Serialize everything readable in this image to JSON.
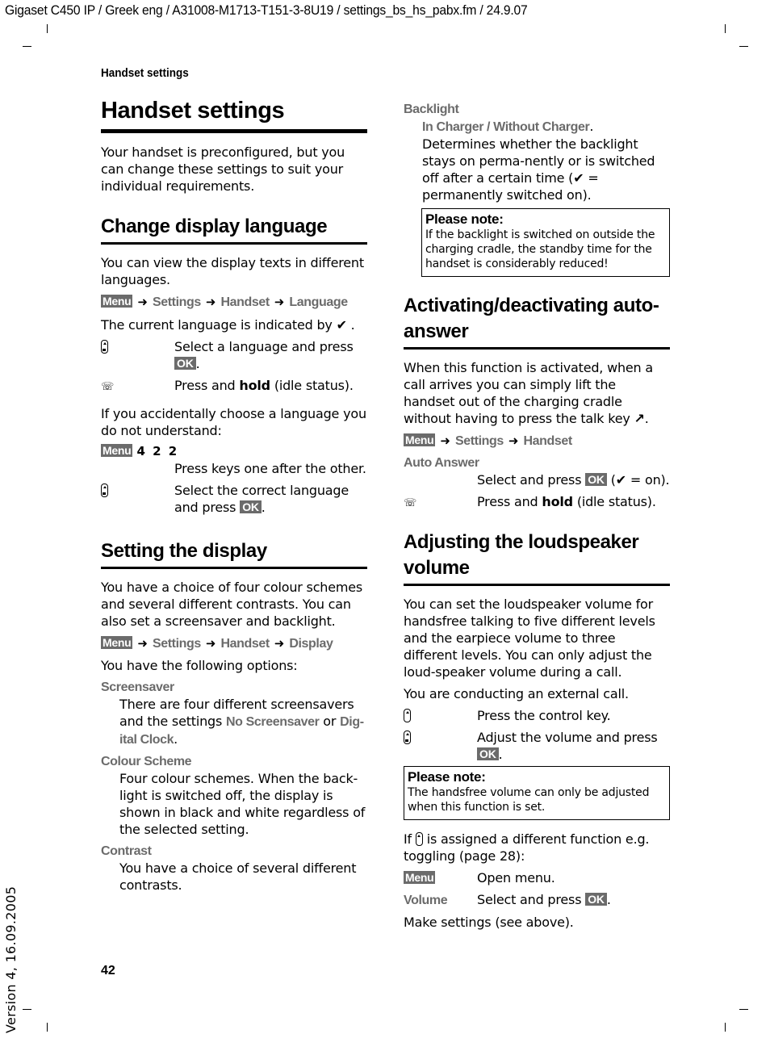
{
  "doc_header": "Gigaset C450 IP / Greek eng / A31008-M1713-T151-3-8U19 / settings_bs_hs_pabx.fm / 24.9.07",
  "running_head": "Handset settings",
  "page_number": "42",
  "version": "Version 4, 16.09.2005",
  "keys": {
    "menu": "Menu",
    "ok": "OK",
    "arrow": "➜",
    "check": "✔"
  },
  "icons": {
    "nav_key": "control-key-up-down",
    "nav_key_up": "control-key-up",
    "end_key": "end-key",
    "talk_key": "talk-key",
    "check": "checkmark"
  },
  "left": {
    "title": "Handset settings",
    "intro": "Your handset is preconfigured, but you can change these settings to suit your individual requirements.",
    "lang": {
      "heading": "Change display language",
      "intro": "You can view the display texts in different languages.",
      "path": [
        "Settings",
        "Handset",
        "Language"
      ],
      "current_text": "The current language is indicated by",
      "step1": "Select a language and press",
      "step2_a": "Press and",
      "step2_b": "hold",
      "step2_c": "(idle status).",
      "accident": "If you accidentally choose a language you do not understand:",
      "key_seq": "4 2 2",
      "step3": "Press keys one after the other.",
      "step4": "Select the correct language and press"
    },
    "display": {
      "heading": "Setting the display",
      "intro": "You have a choice of four colour schemes and several different contrasts. You can also set a screensaver and backlight.",
      "path": [
        "Settings",
        "Handset",
        "Display"
      ],
      "options_intro": "You have the following options:",
      "screensaver_label": "Screensaver",
      "screensaver_text_a": "There are four different screensavers and the settings",
      "screensaver_opt1": "No Screensaver",
      "screensaver_or": "or",
      "screensaver_opt2": "Dig-ital Clock",
      "colour_label": "Colour Scheme",
      "colour_text": "Four colour schemes. When the back-light is switched off, the display is shown in black and white regardless of the selected setting.",
      "contrast_label": "Contrast",
      "contrast_text": "You have a choice of several different contrasts."
    }
  },
  "right": {
    "backlight": {
      "label": "Backlight",
      "opts": "In Charger / Without Charger",
      "text_a": ". Determines whether the backlight stays on perma-nently or is switched off after a certain time (",
      "text_b": "= permanently switched on).",
      "note_title": "Please note:",
      "note_body": "If the backlight is switched on outside the charging cradle, the standby time for the handset is considerably reduced!"
    },
    "auto": {
      "heading": "Activating/deactivating auto-answer",
      "intro": "When this function is activated, when a call arrives you can simply lift the handset out of the charging cradle without having to press the talk key",
      "path": [
        "Settings",
        "Handset"
      ],
      "option": "Auto Answer",
      "step1_a": "Select and press",
      "step1_b": "(",
      "step1_c": "= on).",
      "step2_a": "Press and",
      "step2_b": "hold",
      "step2_c": "(idle status)."
    },
    "volume": {
      "heading": "Adjusting the loudspeaker volume",
      "intro": "You can set the loudspeaker volume for handsfree talking to five different levels and the earpiece volume to three different levels. You can only adjust the loud-speaker volume during a call.",
      "ext_call": "You are conducting an external call.",
      "step1": "Press the control key.",
      "step2": "Adjust the volume and press",
      "note_title": "Please note:",
      "note_body": "The handsfree volume can only be adjusted when this function is set.",
      "if_a": "If",
      "if_b": "is assigned a different function e.g. toggling (page 28):",
      "menu_step": "Open menu.",
      "volume_label": "Volume",
      "volume_step": "Select and press",
      "final": "Make settings (see above)."
    }
  }
}
